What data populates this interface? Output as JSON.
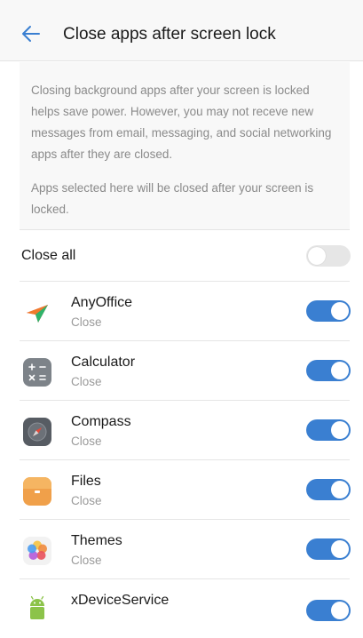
{
  "header": {
    "title": "Close apps after screen lock",
    "back_icon": "arrow-left-icon"
  },
  "description": {
    "paragraph1": "Closing background apps after your screen is locked helps save power. However, you may not receve new messages from email, messaging, and social networking apps after they are closed.",
    "paragraph2": "Apps selected here will be closed after your screen is locked."
  },
  "close_all": {
    "label": "Close all",
    "enabled": false
  },
  "apps": [
    {
      "name": "AnyOffice",
      "status": "Close",
      "enabled": true,
      "icon": "anyoffice-icon"
    },
    {
      "name": "Calculator",
      "status": "Close",
      "enabled": true,
      "icon": "calculator-icon"
    },
    {
      "name": "Compass",
      "status": "Close",
      "enabled": true,
      "icon": "compass-icon"
    },
    {
      "name": "Files",
      "status": "Close",
      "enabled": true,
      "icon": "files-icon"
    },
    {
      "name": "Themes",
      "status": "Close",
      "enabled": true,
      "icon": "themes-icon"
    },
    {
      "name": "xDeviceService",
      "status": "",
      "enabled": true,
      "icon": "android-icon"
    }
  ],
  "colors": {
    "accent": "#3a7fd1",
    "switch_off": "#e6e6e6",
    "secondary_text": "#9a9a9a"
  }
}
